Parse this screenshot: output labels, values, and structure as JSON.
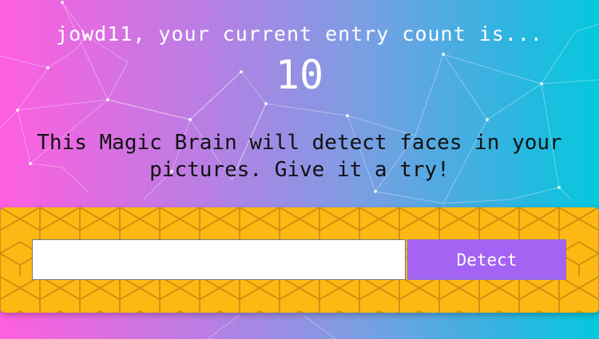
{
  "rank": {
    "greeting": "jowd11, your current entry count is...",
    "count": "10"
  },
  "intro": {
    "text": "This Magic Brain will detect faces in your pictures. Give it a try!"
  },
  "image_form": {
    "input_value": "",
    "button_label": "Detect"
  },
  "colors": {
    "gradient_left": "#ff5edf",
    "gradient_right": "#04c8de",
    "panel_fill": "#fdb813",
    "hex_stroke": "#c8890e",
    "button_fill": "#a463f2"
  }
}
